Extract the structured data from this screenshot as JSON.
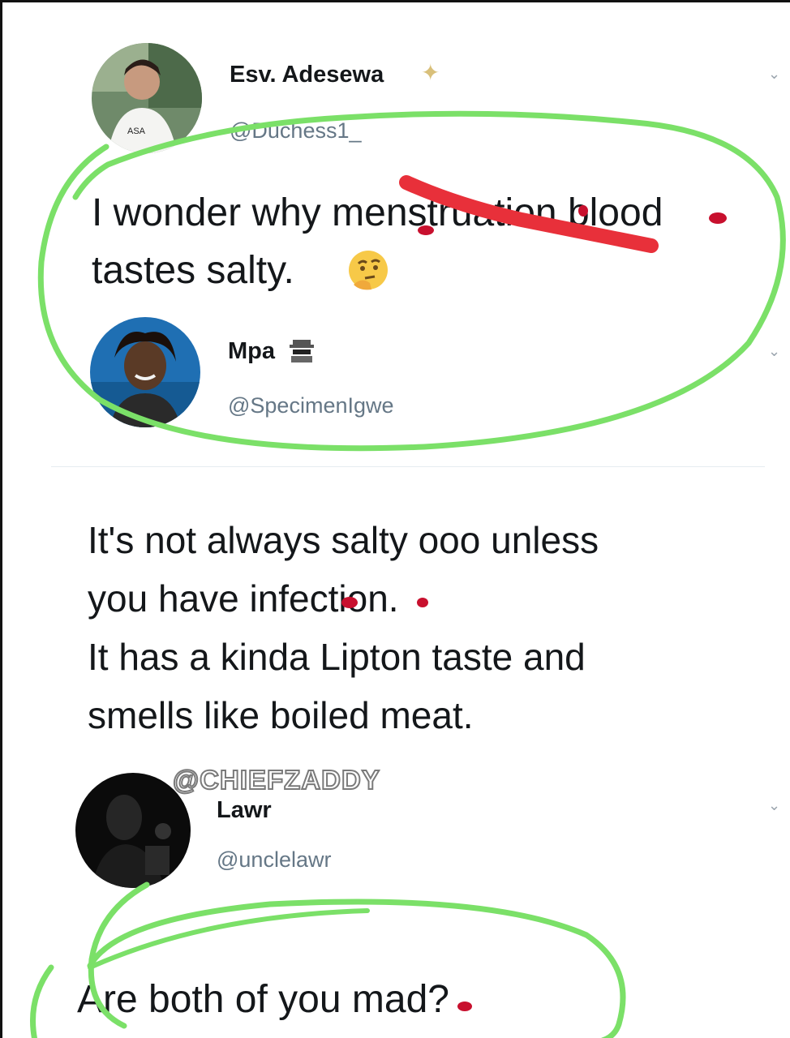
{
  "tweets": [
    {
      "display_name": "Esv. Adesewa",
      "handle": "@Duchess1_",
      "text_lines": [
        "I wonder why menstruation blood",
        "tastes salty."
      ],
      "emoji": "thinking-face-icon"
    },
    {
      "display_name": "Mpa",
      "handle": "@SpecimenIgwe",
      "text_lines": [
        "It's not always salty ooo unless",
        "you have infection.",
        "It has a kinda Lipton taste and",
        "smells like boiled meat."
      ],
      "emoji": "spy-icon"
    },
    {
      "display_name": "Lawr",
      "handle": "@unclelawr",
      "text_lines": [
        "Are both of you mad?"
      ]
    }
  ],
  "watermark": "@CHIEFZADDY",
  "colors": {
    "annotation_green": "#7be068",
    "annotation_red": "#e8303a",
    "blood_red": "#c8102e"
  }
}
